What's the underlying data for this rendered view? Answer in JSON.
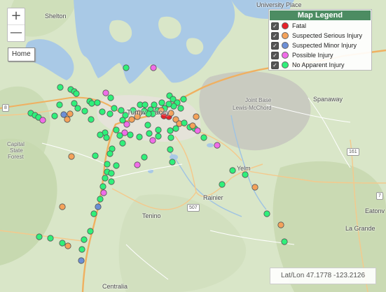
{
  "zoom": {
    "in_label": "+",
    "out_label": "—"
  },
  "home": {
    "label": "Home"
  },
  "legend": {
    "title": "Map Legend",
    "items": [
      {
        "label": "Fatal",
        "color": "#e8222a",
        "checked": true
      },
      {
        "label": "Suspected Serious Injury",
        "color": "#f4a25a",
        "checked": true
      },
      {
        "label": "Suspected Minor Injury",
        "color": "#6c8fd6",
        "checked": true
      },
      {
        "label": "Possible Injury",
        "color": "#f06ce8",
        "checked": true
      },
      {
        "label": "No Apparent Injury",
        "color": "#2ff07a",
        "checked": true
      }
    ]
  },
  "coords": {
    "text": "Lat/Lon 47.1778 -123.2126"
  },
  "places": {
    "shelton": "Shelton",
    "university_place": "University Place",
    "tumwater_partial": "Tumw",
    "lacey_partial": "acey",
    "joint_base": "Joint Base",
    "lewis_mcchord": "Lewis-McChord",
    "spanaway": "Spanaway",
    "capital": "Capital",
    "state": "State",
    "forest": "Forest",
    "yelm": "Yelm",
    "rainier": "Rainier",
    "tenino": "Tenino",
    "la_grande": "La Grande",
    "eatonville_partial": "Eatonv",
    "centralia": "Centralia"
  },
  "highways": {
    "h8": "8",
    "h507": "507",
    "h161": "161",
    "h7": "7"
  },
  "incident_counts": {
    "fatal": 2,
    "serious": 16,
    "minor": 4,
    "possible": 13,
    "none": 82
  }
}
